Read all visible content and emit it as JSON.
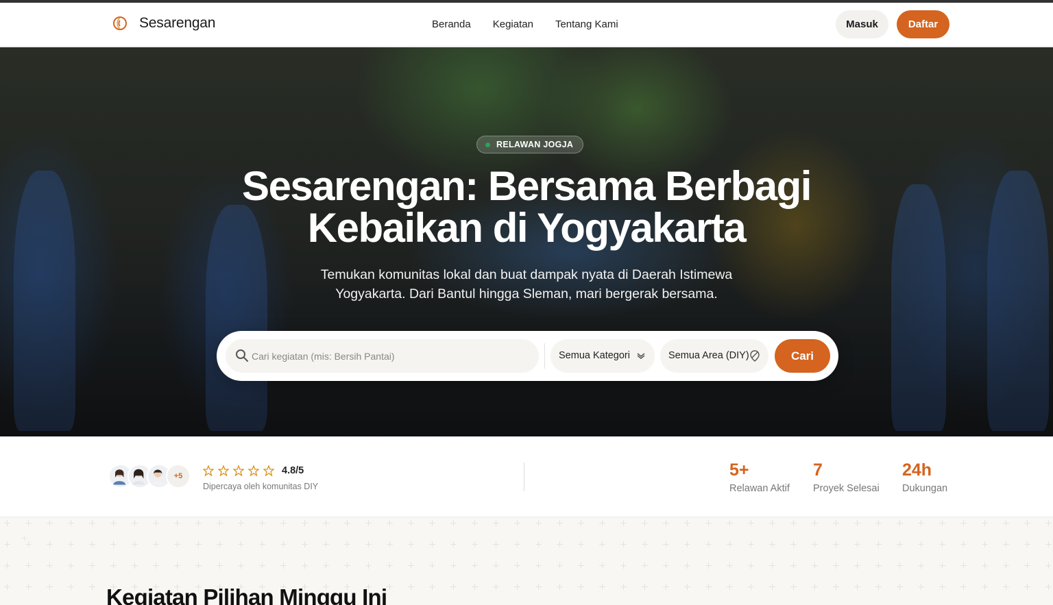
{
  "brand": {
    "name": "Sesarengan",
    "logo_icon": "sun-swirl-logo-icon"
  },
  "nav": {
    "links": [
      "Beranda",
      "Kegiatan",
      "Tentang Kami"
    ]
  },
  "auth": {
    "login_label": "Masuk",
    "register_label": "Daftar"
  },
  "hero": {
    "badge": "RELAWAN JOGJA",
    "title_line1": "Sesarengan: Bersama Berbagi",
    "title_line2": "Kebaikan di Yogyakarta",
    "subtitle_line1": "Temukan komunitas lokal dan buat dampak nyata di Daerah Istimewa",
    "subtitle_line2": "Yogyakarta. Dari Bantul hingga Sleman, mari bergerak bersama."
  },
  "search": {
    "placeholder": "Cari kegiatan (mis: Bersih Pantai)",
    "value": "",
    "category_selected": "Semua Kategori",
    "area_selected": "Semua Area (DIY)",
    "button_label": "Cari"
  },
  "stats": {
    "avatars_more": "+5",
    "rating": "4.8/5",
    "stars": 5,
    "trust_text": "Dipercaya oleh komunitas DIY",
    "items": [
      {
        "value": "5+",
        "label": "Relawan Aktif"
      },
      {
        "value": "7",
        "label": "Proyek Selesai"
      },
      {
        "value": "24h",
        "label": "Dukungan"
      }
    ]
  },
  "section": {
    "title": "Kegiatan Pilihan Minggu Ini"
  },
  "colors": {
    "accent": "#d4641f",
    "star": "#d9931f",
    "badge_dot": "#2fa05a"
  }
}
